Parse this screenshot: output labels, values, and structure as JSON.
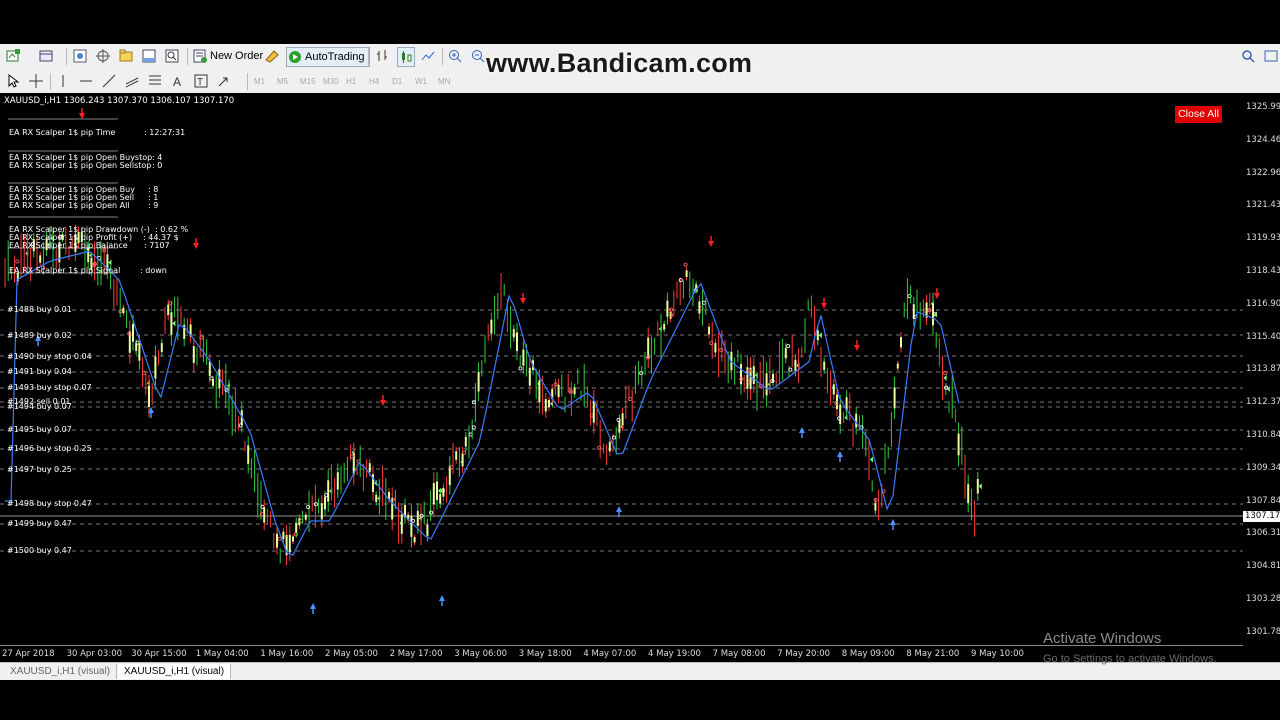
{
  "toolbar": {
    "new_order": "New Order",
    "autotrading": "AutoTrading",
    "timeframes": [
      "M1",
      "M5",
      "M15",
      "M30",
      "H1",
      "H4",
      "D1",
      "W1",
      "MN"
    ]
  },
  "watermark": "www.Bandicam.com",
  "chart": {
    "symbol_info": "XAUUSD_i,H1  1306.243 1307.370 1306.107 1307.170",
    "close_all_label": "Close All",
    "panel": {
      "time_label": "EA RX Scalper 1$ pip Time",
      "time_value": ": 12:27:31",
      "open_buystop_label": "EA RX Scalper 1$ pip Open Buystop",
      "open_buystop_value": ": 4",
      "open_sellstop_label": "EA RX Scalper 1$ pip Open Sellstop",
      "open_sellstop_value": ": 0",
      "open_buy_label": "EA RX Scalper 1$ pip Open Buy",
      "open_buy_value": ": 8",
      "open_sell_label": "EA RX Scalper 1$ pip Open Sell",
      "open_sell_value": ": 1",
      "open_all_label": "EA RX Scalper 1$ pip Open All",
      "open_all_value": ": 9",
      "drawdown_label": "EA RX Scalper 1$ pip Drawdown (-)",
      "drawdown_value": ": 0.62 %",
      "profit_label": "EA RX Scalper 1$ pip Profit    (+)",
      "profit_value": ": 44.37 $",
      "balance_label": "EA RX Scalper 1$ pip Balance",
      "balance_value": ": 7107",
      "signal_label": "EA RX Scalper 1$ pip Signal",
      "signal_value": ": down"
    },
    "orders": [
      "#1488 buy 0.01",
      "#1489 buy 0.02",
      "#1490 buy stop 0.04",
      "#1491 buy 0.04",
      "#1493 buy stop 0.07",
      "#1492 sell 0.01",
      "#1494 buy 0.07",
      "#1495 buy 0.07",
      "#1496 buy stop 0.25",
      "#1497 buy 0.25",
      "#1498 buy stop 0.47",
      "#1499 buy 0.47",
      "#1500 buy 0.47"
    ],
    "price_labels": [
      "1325.990",
      "1324.460",
      "1322.960",
      "1321.430",
      "1319.930",
      "1318.430",
      "1316.900",
      "1315.400",
      "1313.870",
      "1312.370",
      "1310.840",
      "1309.340",
      "1307.840",
      "1306.310",
      "1304.810",
      "1303.280",
      "1301.780"
    ],
    "current_price": "1307.170",
    "time_labels": [
      "27 Apr 2018",
      "30 Apr 03:00",
      "30 Apr 15:00",
      "1 May 04:00",
      "1 May 16:00",
      "2 May 05:00",
      "2 May 17:00",
      "3 May 06:00",
      "3 May 18:00",
      "4 May 07:00",
      "4 May 19:00",
      "7 May 08:00",
      "7 May 20:00",
      "8 May 09:00",
      "8 May 21:00",
      "9 May 10:00"
    ]
  },
  "tabs": [
    "XAUUSD_i,H1 (visual)",
    "XAUUSD_i,H1 (visual)"
  ],
  "activate_windows": {
    "title": "Activate Windows",
    "subtitle": "Go to Settings to activate Windows."
  }
}
